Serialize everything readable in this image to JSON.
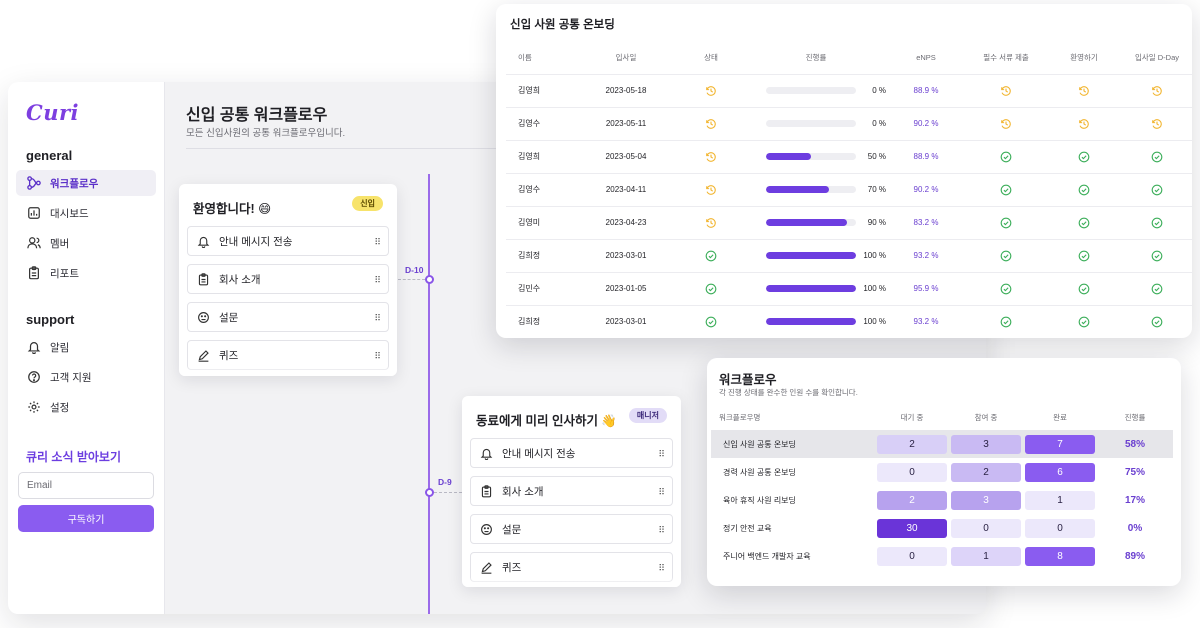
{
  "app": {
    "logo": "Curi",
    "general_title": "general",
    "support_title": "support",
    "nav_general": [
      {
        "label": "워크플로우",
        "icon": "workflow-icon",
        "active": true
      },
      {
        "label": "대시보드",
        "icon": "dashboard-icon",
        "active": false
      },
      {
        "label": "멤버",
        "icon": "members-icon",
        "active": false
      },
      {
        "label": "리포트",
        "icon": "report-icon",
        "active": false
      }
    ],
    "nav_support": [
      {
        "label": "알림",
        "icon": "bell-icon"
      },
      {
        "label": "고객 지원",
        "icon": "help-icon"
      },
      {
        "label": "설정",
        "icon": "gear-icon"
      }
    ],
    "newsletter": {
      "title": "큐리 소식 받아보기",
      "email_placeholder": "Email",
      "button": "구독하기"
    }
  },
  "workflow_page": {
    "title": "신입 공통 워크플로우",
    "subtitle": "모든 신입사원의 공통 워크플로우입니다.",
    "steps": [
      {
        "day": "D-10",
        "title": "환영합니다! 😄",
        "badge": "신입",
        "items": [
          {
            "label": "안내 메시지 전송",
            "icon": "bell-icon"
          },
          {
            "label": "회사 소개",
            "icon": "clipboard-icon"
          },
          {
            "label": "설문",
            "icon": "survey-icon"
          },
          {
            "label": "퀴즈",
            "icon": "pencil-icon"
          }
        ]
      },
      {
        "day": "D-9",
        "title": "동료에게 미리 인사하기 👋",
        "badge": "매니저",
        "items": [
          {
            "label": "안내 메시지 전송",
            "icon": "bell-icon"
          },
          {
            "label": "회사 소개",
            "icon": "clipboard-icon"
          },
          {
            "label": "설문",
            "icon": "survey-icon"
          },
          {
            "label": "퀴즈",
            "icon": "pencil-icon"
          }
        ]
      }
    ]
  },
  "onboarding": {
    "title": "신입 사원 공통 온보딩",
    "columns": [
      "이름",
      "입사일",
      "상태",
      "진행률",
      "eNPS",
      "필수 서류 제출",
      "환영하기",
      "입사일 D-Day"
    ],
    "rows": [
      {
        "name": "김영희",
        "date": "2023-05-18",
        "status": "pending",
        "progress": 0,
        "progress_label": "0 %",
        "enps": "88.9 %",
        "docs": "pending",
        "welcome": "pending",
        "dday": "pending"
      },
      {
        "name": "김영수",
        "date": "2023-05-11",
        "status": "pending",
        "progress": 0,
        "progress_label": "0 %",
        "enps": "90.2 %",
        "docs": "pending",
        "welcome": "pending",
        "dday": "pending"
      },
      {
        "name": "김영희",
        "date": "2023-05-04",
        "status": "pending",
        "progress": 50,
        "progress_label": "50 %",
        "enps": "88.9 %",
        "docs": "done",
        "welcome": "done",
        "dday": "done"
      },
      {
        "name": "김영수",
        "date": "2023-04-11",
        "status": "pending",
        "progress": 70,
        "progress_label": "70 %",
        "enps": "90.2 %",
        "docs": "done",
        "welcome": "done",
        "dday": "done"
      },
      {
        "name": "김영미",
        "date": "2023-04-23",
        "status": "pending",
        "progress": 90,
        "progress_label": "90 %",
        "enps": "83.2 %",
        "docs": "done",
        "welcome": "done",
        "dday": "done"
      },
      {
        "name": "김희정",
        "date": "2023-03-01",
        "status": "done",
        "progress": 100,
        "progress_label": "100 %",
        "enps": "93.2 %",
        "docs": "done",
        "welcome": "done",
        "dday": "done"
      },
      {
        "name": "김민수",
        "date": "2023-01-05",
        "status": "done",
        "progress": 100,
        "progress_label": "100 %",
        "enps": "95.9 %",
        "docs": "done",
        "welcome": "done",
        "dday": "done"
      },
      {
        "name": "김희정",
        "date": "2023-03-01",
        "status": "done",
        "progress": 100,
        "progress_label": "100 %",
        "enps": "93.2 %",
        "docs": "done",
        "welcome": "done",
        "dday": "done"
      }
    ]
  },
  "workflow_summary": {
    "title": "워크플로우",
    "subtitle": "각 진행 상태를 완수한 인원 수를 확인합니다.",
    "columns": [
      "워크플로우명",
      "대기 중",
      "참여 중",
      "완료",
      "진행률"
    ],
    "rows": [
      {
        "name": "신입 사원 공통 온보딩",
        "waiting": "2",
        "active": "3",
        "done": "7",
        "rate": "58%",
        "selected": true
      },
      {
        "name": "경력 사원 공통 온보딩",
        "waiting": "0",
        "active": "2",
        "done": "6",
        "rate": "75%",
        "selected": false
      },
      {
        "name": "육아 휴직 사원 리보딩",
        "waiting": "2",
        "active": "3",
        "done": "1",
        "rate": "17%",
        "selected": false
      },
      {
        "name": "정기 안전 교육",
        "waiting": "30",
        "active": "0",
        "done": "0",
        "rate": "0%",
        "selected": false
      },
      {
        "name": "주니어 백엔드 개발자 교육",
        "waiting": "0",
        "active": "1",
        "done": "8",
        "rate": "89%",
        "selected": false
      }
    ]
  },
  "colors": {
    "brand": "#7d3fe0",
    "progress_fill": "#6d3de0",
    "pending": "#f2b632",
    "done": "#3cae5a",
    "badge_new_bg": "#f7e36b",
    "badge_manager_bg": "#e2dcf7"
  }
}
